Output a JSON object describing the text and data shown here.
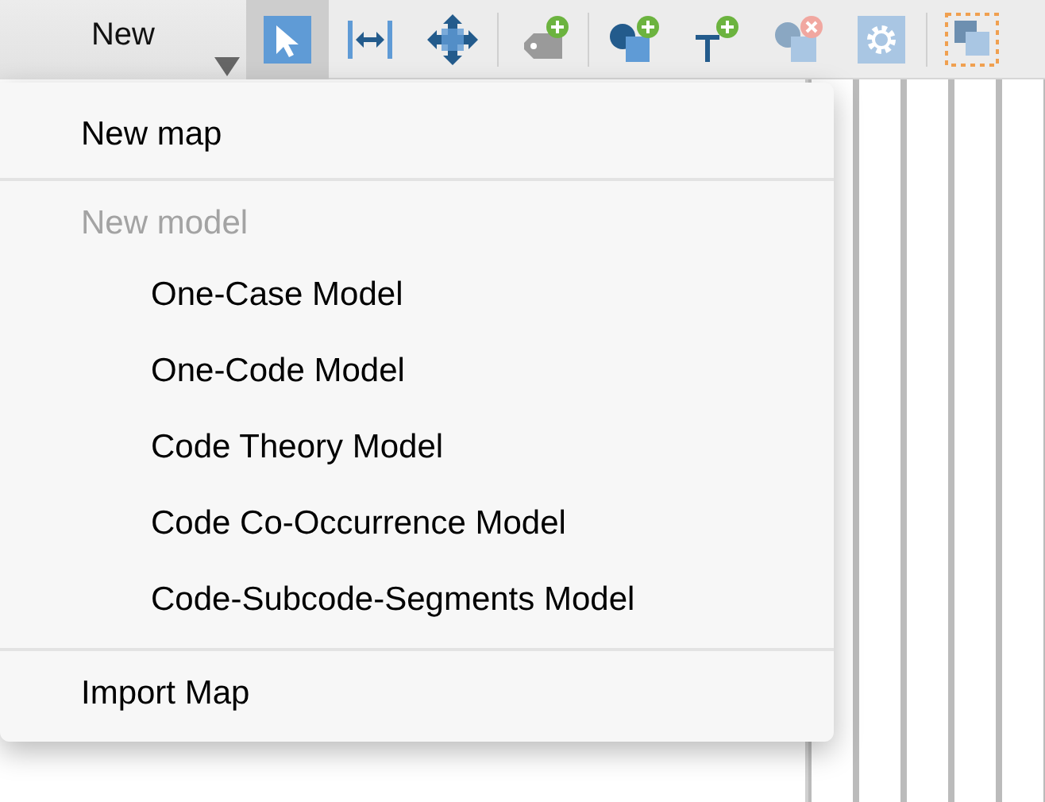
{
  "toolbar": {
    "new_button": {
      "label": "New"
    },
    "tools": [
      {
        "kind": "tool",
        "selected": true
      },
      {
        "kind": "tool",
        "selected": false
      },
      {
        "kind": "tool",
        "selected": false
      },
      {
        "kind": "separator"
      },
      {
        "kind": "tool",
        "selected": false
      },
      {
        "kind": "separator"
      },
      {
        "kind": "tool",
        "selected": false
      },
      {
        "kind": "tool",
        "selected": false
      },
      {
        "kind": "tool",
        "selected": false
      },
      {
        "kind": "tool",
        "selected": false
      },
      {
        "kind": "separator"
      },
      {
        "kind": "tool",
        "selected": false
      }
    ]
  },
  "menu": {
    "items": [
      {
        "kind": "item",
        "label": "New map",
        "disabled": false
      },
      {
        "kind": "separator"
      },
      {
        "kind": "item",
        "label": "New model",
        "disabled": true
      },
      {
        "kind": "subitem",
        "label": "One-Case Model",
        "disabled": false
      },
      {
        "kind": "subitem",
        "label": "One-Code Model",
        "disabled": false
      },
      {
        "kind": "subitem",
        "label": "Code Theory Model",
        "disabled": false
      },
      {
        "kind": "subitem",
        "label": "Code Co-Occurrence Model",
        "disabled": false
      },
      {
        "kind": "subitem",
        "label": "Code-Subcode-Segments Model",
        "disabled": false
      },
      {
        "kind": "separator"
      },
      {
        "kind": "item",
        "label": "Import Map",
        "disabled": false
      }
    ]
  }
}
